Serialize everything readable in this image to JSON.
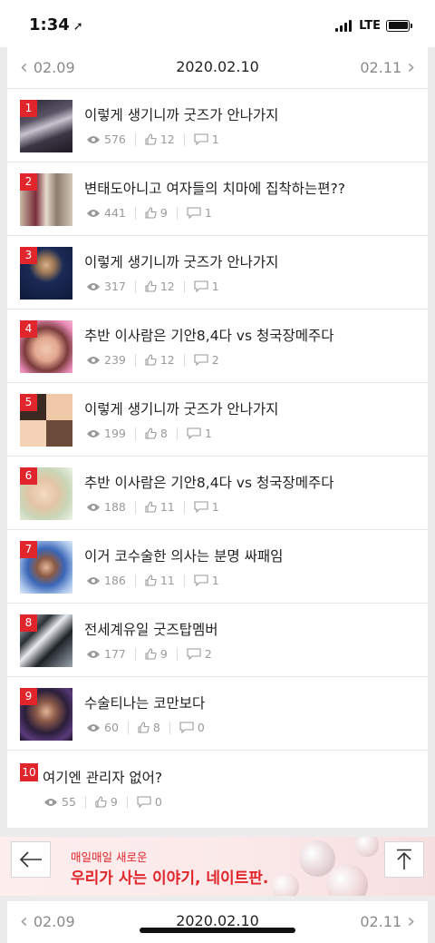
{
  "status_bar": {
    "time": "1:34",
    "network": "LTE"
  },
  "date_nav": {
    "prev": "02.09",
    "current": "2020.02.10",
    "next": "02.11"
  },
  "items": [
    {
      "rank": "1",
      "title": "이렇게 생기니까 굿즈가 안나가지",
      "views": "576",
      "likes": "12",
      "comments": "1"
    },
    {
      "rank": "2",
      "title": "변태도아니고 여자들의 치마에 집착하는편??",
      "views": "441",
      "likes": "9",
      "comments": "1"
    },
    {
      "rank": "3",
      "title": "이렇게 생기니까 굿즈가 안나가지",
      "views": "317",
      "likes": "12",
      "comments": "1"
    },
    {
      "rank": "4",
      "title": "추반 이사람은 기안8,4다 vs 청국장메주다",
      "views": "239",
      "likes": "12",
      "comments": "2"
    },
    {
      "rank": "5",
      "title": "이렇게 생기니까 굿즈가 안나가지",
      "views": "199",
      "likes": "8",
      "comments": "1"
    },
    {
      "rank": "6",
      "title": "추반 이사람은 기안8,4다 vs 청국장메주다",
      "views": "188",
      "likes": "11",
      "comments": "1"
    },
    {
      "rank": "7",
      "title": "이거 코수술한 의사는 분명 싸패임",
      "views": "186",
      "likes": "11",
      "comments": "1"
    },
    {
      "rank": "8",
      "title": "전세계유일 굿즈탑멤버",
      "views": "177",
      "likes": "9",
      "comments": "2"
    },
    {
      "rank": "9",
      "title": "수술티나는 코만보다",
      "views": "60",
      "likes": "8",
      "comments": "0"
    },
    {
      "rank": "10",
      "title": "여기엔 관리자 없어?",
      "views": "55",
      "likes": "9",
      "comments": "0"
    }
  ],
  "banner": {
    "subtitle": "매일매일 새로운",
    "title": "우리가 사는 이야기, 네이트판."
  },
  "date_nav_bottom": {
    "prev": "02.09",
    "current": "2020.02.10",
    "next": "02.11"
  },
  "colors": {
    "accent": "#e0262c",
    "meta_gray": "#9a9a9a",
    "background": "#ececec"
  },
  "icons": [
    "location-arrow-icon",
    "signal-icon",
    "battery-icon",
    "chevron-left-icon",
    "chevron-right-icon",
    "eye-icon",
    "thumbs-up-icon",
    "comment-icon",
    "back-arrow-icon",
    "scroll-top-icon"
  ]
}
